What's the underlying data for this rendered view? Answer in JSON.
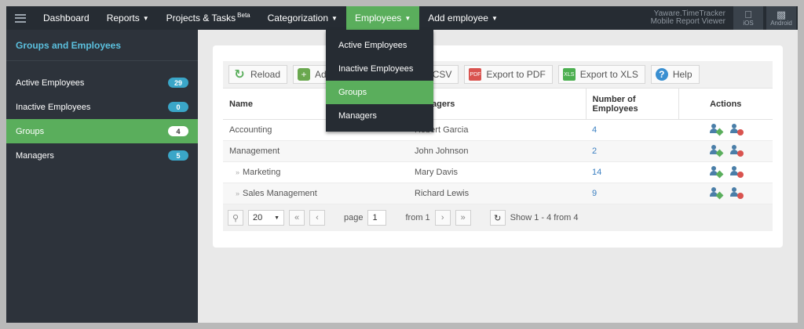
{
  "nav": {
    "items": [
      {
        "label": "Dashboard",
        "caret": false,
        "sup": ""
      },
      {
        "label": "Reports",
        "caret": true,
        "sup": ""
      },
      {
        "label": "Projects & Tasks",
        "caret": false,
        "sup": "Beta"
      },
      {
        "label": "Categorization",
        "caret": true,
        "sup": ""
      },
      {
        "label": "Employees",
        "caret": true,
        "sup": "",
        "active": true
      },
      {
        "label": "Add employee",
        "caret": true,
        "sup": ""
      }
    ],
    "mobile_line1": "Yaware.TimeTracker",
    "mobile_line2": "Mobile Report Viewer",
    "ios_label": "iOS",
    "android_label": "Android"
  },
  "dropdown": {
    "items": [
      "Active Employees",
      "Inactive Employees",
      "Groups",
      "Managers"
    ],
    "active_index": 2
  },
  "sidebar": {
    "title": "Groups and Employees",
    "items": [
      {
        "label": "Active Employees",
        "count": "29"
      },
      {
        "label": "Inactive Employees",
        "count": "0"
      },
      {
        "label": "Groups",
        "count": "4",
        "active": true
      },
      {
        "label": "Managers",
        "count": "5"
      }
    ]
  },
  "toolbar": {
    "reload": "Reload",
    "add": "Add",
    "export_csv": "Export to CSV",
    "export_pdf": "Export to PDF",
    "export_xls": "Export to XLS",
    "help": "Help"
  },
  "table": {
    "headers": {
      "name": "Name",
      "managers": "Managers",
      "number": "Number of Employees",
      "actions": "Actions"
    },
    "rows": [
      {
        "name": "Accounting",
        "manager": "Robert Garcia",
        "count": "4",
        "sub": false
      },
      {
        "name": "Management",
        "manager": "John Johnson",
        "count": "2",
        "sub": false
      },
      {
        "name": "Marketing",
        "manager": "Mary Davis",
        "count": "14",
        "sub": true
      },
      {
        "name": "Sales Management",
        "manager": "Richard Lewis",
        "count": "9",
        "sub": true
      }
    ]
  },
  "pager": {
    "page_size": "20",
    "page_label": "page",
    "page_value": "1",
    "from_label": "from 1",
    "summary": "Show 1 - 4 from 4"
  },
  "colors": {
    "accent": "#5aae5c",
    "nav_bg": "#262c33",
    "sidebar_bg": "#2d333b",
    "badge": "#3aa6c8",
    "link": "#3a7fc1"
  }
}
